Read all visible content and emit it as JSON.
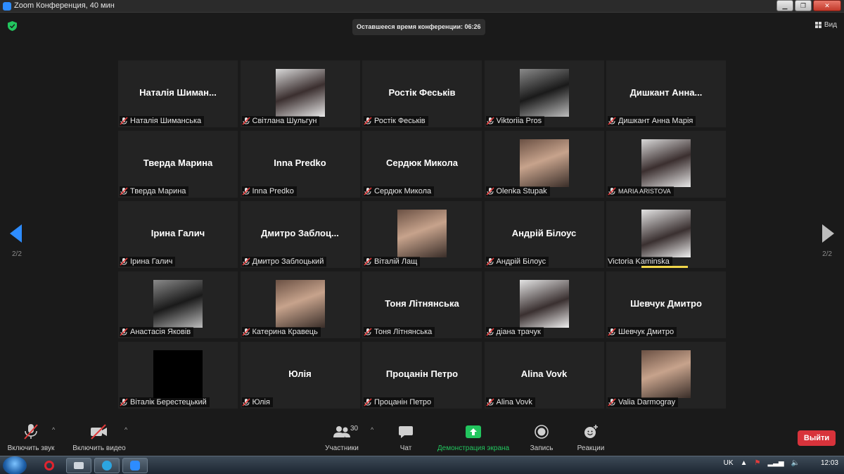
{
  "window": {
    "title": "Zoom Конференция, 40 мин"
  },
  "meeting": {
    "timer_text": "Оставшееся время конференции: 06:26",
    "view_label": "Вид",
    "page_left": "2/2",
    "page_right": "2/2"
  },
  "tiles": [
    {
      "big": "Наталія  Шиман...",
      "name": "Наталія Шиманська",
      "photo": false
    },
    {
      "big": "",
      "name": "Світлана Шульгун",
      "photo": true,
      "photo_icon": "portrait-photo-icon"
    },
    {
      "big": "Ростік Феськів",
      "name": "Ростік Феськів",
      "photo": false
    },
    {
      "big": "",
      "name": "Viktoriia Pros",
      "photo": true,
      "photo_icon": "portrait-photo-icon"
    },
    {
      "big": "Дишкант  Анна...",
      "name": "Дишкант Анна Марія",
      "photo": false
    },
    {
      "big": "Тверда Марина",
      "name": "Тверда Марина",
      "photo": false
    },
    {
      "big": "Inna Predko",
      "name": "Inna Predko",
      "photo": false
    },
    {
      "big": "Сердюк Микола",
      "name": "Сердюк Микола",
      "photo": false
    },
    {
      "big": "",
      "name": "Olenka Stupak",
      "photo": true,
      "photo_icon": "portrait-photo-icon"
    },
    {
      "big": "",
      "name": "MARIA ARISTOVA",
      "photo": true,
      "photo_icon": "portrait-photo-icon"
    },
    {
      "big": "Ірина Галич",
      "name": "Ірина Галич",
      "photo": false
    },
    {
      "big": "Дмитро  Заблоц...",
      "name": "Дмитро Заблоцький",
      "photo": false
    },
    {
      "big": "",
      "name": "Віталій Лащ",
      "photo": true,
      "photo_icon": "portrait-photo-icon"
    },
    {
      "big": "Андрій Білоус",
      "name": "Андрій Білоус",
      "photo": false
    },
    {
      "big": "",
      "name": "Victoria Kaminska",
      "photo": true,
      "photo_icon": "portrait-photo-icon",
      "speaking": true
    },
    {
      "big": "",
      "name": "Анастасія Яковів",
      "photo": true,
      "photo_icon": "portrait-photo-icon"
    },
    {
      "big": "",
      "name": "Катерина Кравець",
      "photo": true,
      "photo_icon": "portrait-photo-icon"
    },
    {
      "big": "Тоня Літнянська",
      "name": "Тоня Літнянська",
      "photo": false
    },
    {
      "big": "",
      "name": "діана трачук",
      "photo": true,
      "photo_icon": "portrait-photo-icon"
    },
    {
      "big": "Шевчук Дмитро",
      "name": "Шевчук Дмитро",
      "photo": false
    },
    {
      "big": "",
      "name": "Віталік Берестецький",
      "photo": true,
      "photo_icon": "black-avatar-icon"
    },
    {
      "big": "Юлія",
      "name": "Юлія",
      "photo": false
    },
    {
      "big": "Процанін Петро",
      "name": "Процанін Петро",
      "photo": false
    },
    {
      "big": "Alina Vovk",
      "name": "Alina Vovk",
      "photo": false
    },
    {
      "big": "",
      "name": "Valia Darmogray",
      "photo": true,
      "photo_icon": "portrait-photo-icon"
    }
  ],
  "toolbar": {
    "audio_label": "Включить звук",
    "video_label": "Включить видео",
    "participants_label": "Участники",
    "participants_count": "30",
    "chat_label": "Чат",
    "share_label": "Демонстрация экрана",
    "record_label": "Запись",
    "reactions_label": "Реакции",
    "leave_label": "Выйти"
  },
  "taskbar": {
    "language": "UK",
    "clock": "12:03"
  },
  "colors": {
    "accent_green": "#22c55e",
    "leave_red": "#d8333b",
    "speaking_yellow": "#f1d64a",
    "tile_bg": "#232323"
  }
}
